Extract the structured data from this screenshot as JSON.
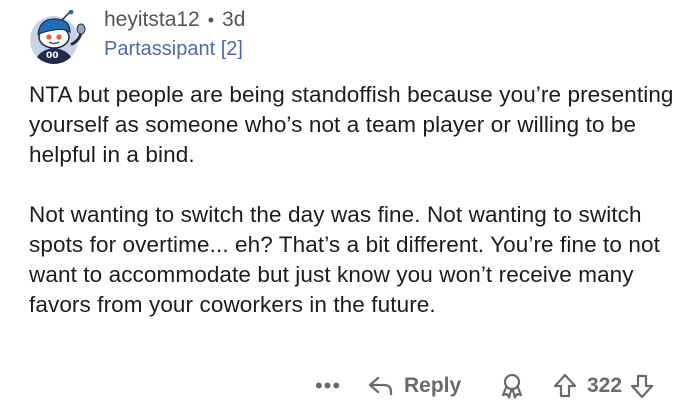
{
  "comment": {
    "author": "heyitsta12",
    "separator": "•",
    "age": "3d",
    "flair": "Partassipant [2]",
    "avatar_badge": "00",
    "paragraphs": [
      "NTA but people are being standoffish because you’re presenting yourself as someone who’s not a team player or willing to be helpful in a bind.",
      "Not wanting to switch the day was fine. Not wanting to switch spots for overtime... eh? That’s a bit different. You’re fine to not want to accommodate but just know you won’t receive many favors from your coworkers in the future."
    ]
  },
  "actions": {
    "more_label": "•••",
    "reply_label": "Reply",
    "vote_count": "322"
  },
  "icons": {
    "reply": "reply-arrow-icon",
    "award": "award-icon",
    "upvote": "upvote-arrow-icon",
    "downvote": "downvote-arrow-icon",
    "more": "more-options-icon"
  },
  "colors": {
    "flair": "#4f6aa8",
    "meta": "#545454",
    "action": "#6a6a6a",
    "text": "#1c1c1c"
  }
}
